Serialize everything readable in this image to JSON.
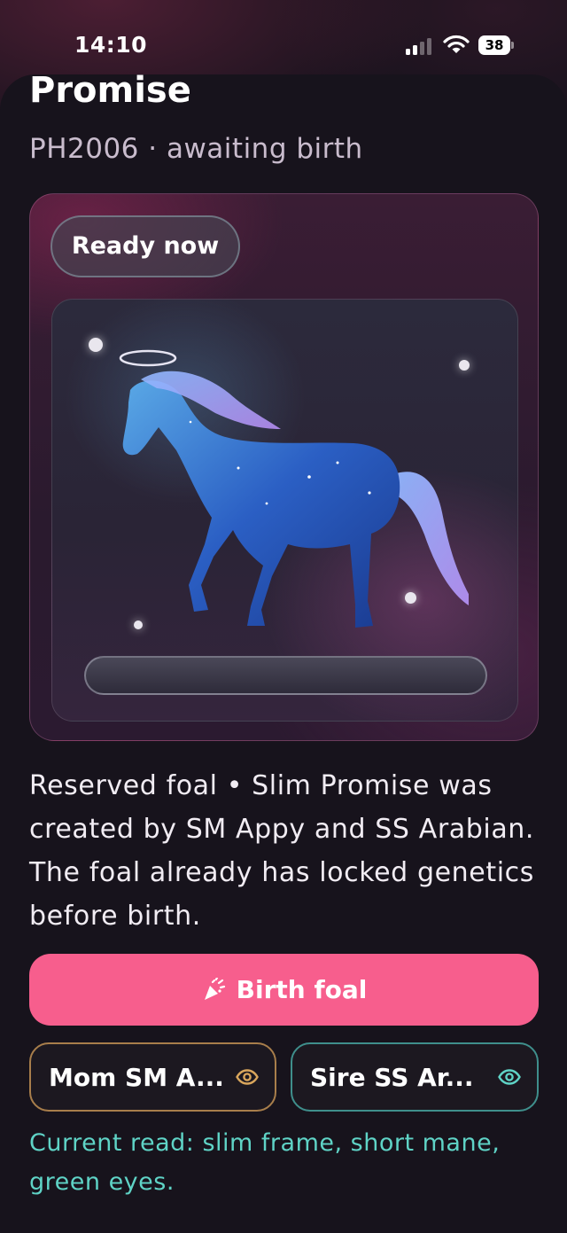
{
  "status_bar": {
    "time": "14:10",
    "battery": "38"
  },
  "header": {
    "title": "Promise",
    "subtitle": "PH2006 · awaiting birth"
  },
  "card": {
    "status_pill": "Ready now"
  },
  "description": "Reserved foal • Slim Promise was created by SM Appy and SS Arabian. The foal already has locked genetics before birth.",
  "actions": {
    "birth_label": "Birth foal",
    "birth_icon": "party-popper-icon",
    "mom_label": "Mom SM A...",
    "sire_label": "Sire SS Ar...",
    "view_icon": "eye-icon"
  },
  "current_read": "Current read: slim frame, short mane, green eyes.",
  "colors": {
    "accent_pink": "#f75e8d",
    "mom_gold": "#d9a65c",
    "sire_teal": "#5fd3c6",
    "background": "#16121c"
  }
}
